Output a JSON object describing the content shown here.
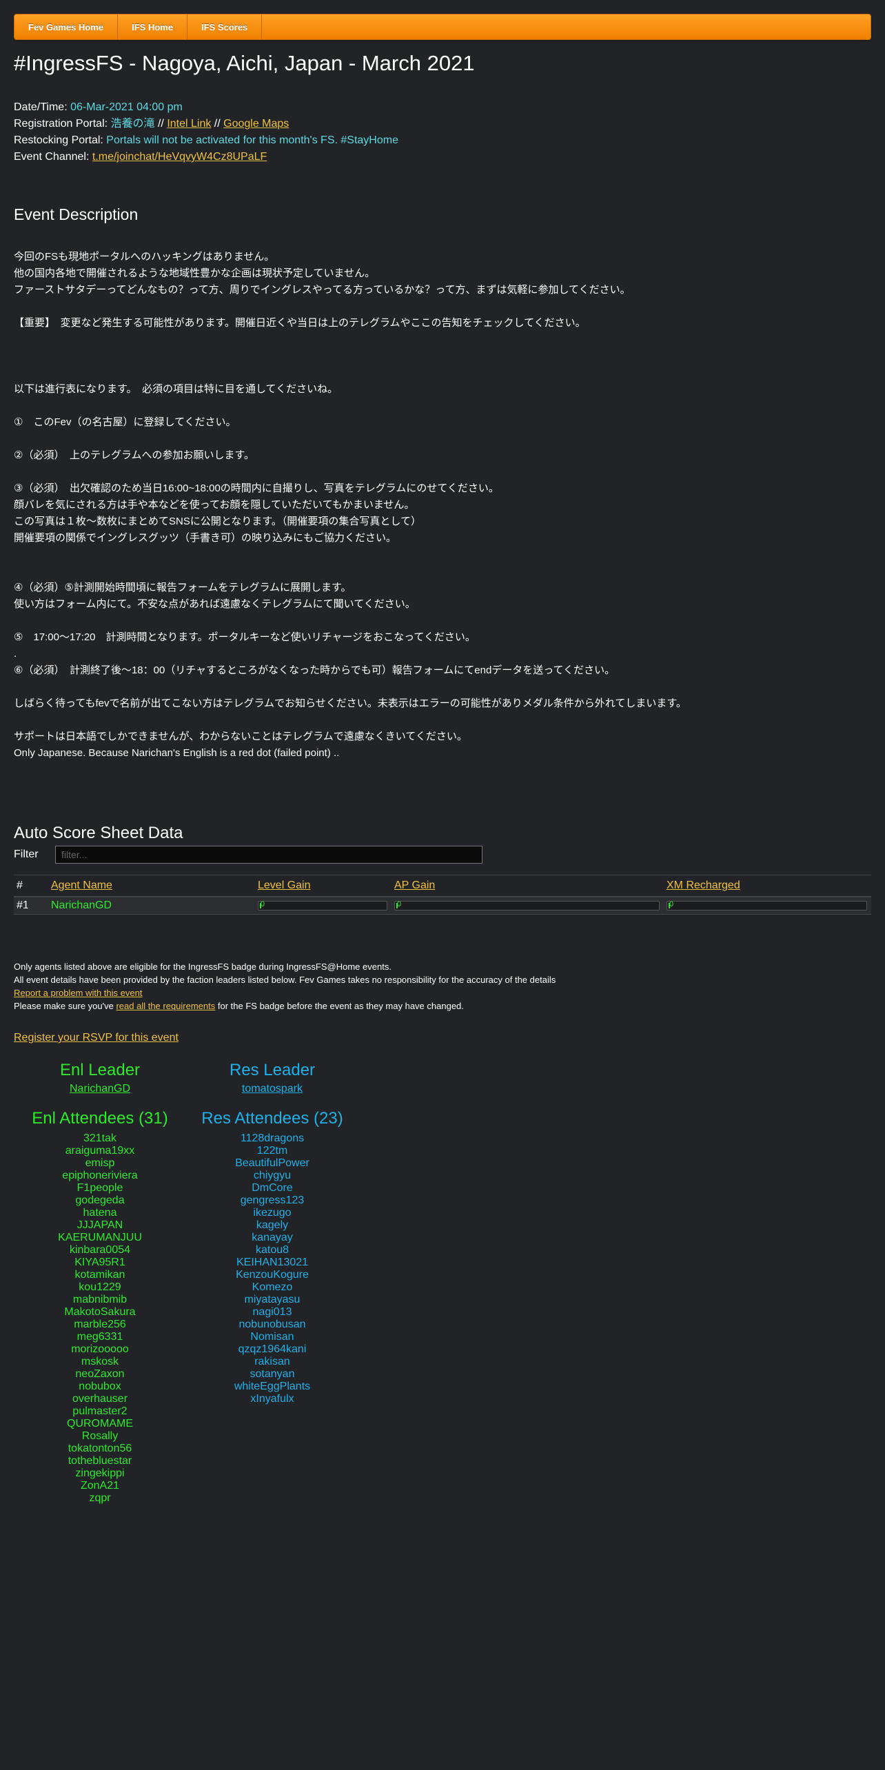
{
  "nav": {
    "items": [
      {
        "label": "Fev Games Home"
      },
      {
        "label": "IFS Home"
      },
      {
        "label": "IFS Scores"
      }
    ]
  },
  "title": "#IngressFS - Nagoya, Aichi, Japan - March 2021",
  "info": {
    "datetime_label": "Date/Time:",
    "datetime_value": "06-Mar-2021 04:00 pm",
    "reg_label": "Registration Portal:",
    "reg_portal": "浩養の滝",
    "sep1": " // ",
    "intel_link": "Intel Link",
    "sep2": " // ",
    "maps_link": "Google Maps",
    "restock_label": "Restocking Portal:",
    "restock_value": "Portals will not be activated for this month's FS. #StayHome",
    "channel_label": "Event Channel:",
    "channel_link": "t.me/joinchat/HeVqvyW4Cz8UPaLF"
  },
  "description": {
    "heading": "Event Description",
    "lines": [
      "今回のFSも現地ポータルへのハッキングはありません。",
      "他の国内各地で開催されるような地域性豊かな企画は現状予定していません。",
      "ファーストサタデーってどんなもの？って方、周りでイングレスやってる方っているかな？って方、まずは気軽に参加してください。",
      "",
      "【重要】　変更など発生する可能性があります。開催日近くや当日は上のテレグラムやここの告知をチェックしてください。",
      "",
      "",
      "",
      "以下は進行表になります。　必須の項目は特に目を通してくださいね。",
      "",
      "①　このFev（の名古屋）に登録してください。",
      "",
      "②（必須）　上のテレグラムへの参加お願いします。",
      "",
      "③（必須）　出欠確認のため当日16:00~18:00の時間内に自撮りし、写真をテレグラムにのせてください。",
      "顔バレを気にされる方は手や本などを使ってお顔を隠していただいてもかまいません。",
      "この写真は１枚～数枚にまとめてSNSに公開となります。（開催要項の集合写真として）",
      "開催要項の関係でイングレスグッツ（手書き可）の映り込みにもご協力ください。",
      "",
      "",
      "④（必須）⑤計測開始時間頃に報告フォームをテレグラムに展開します。",
      "使い方はフォーム内にて。不安な点があれば遠慮なくテレグラムにて聞いてください。",
      "",
      "⑤　17:00～17:20　計測時間となります。ポータルキーなど使いリチャージをおこなってください。",
      ".",
      "⑥（必須）　計測終了後～18：00（リチャするところがなくなった時からでも可）報告フォームにてendデータを送ってください。",
      "",
      "しばらく待ってもfevで名前が出てこない方はテレグラムでお知らせください。未表示はエラーの可能性がありメダル条件から外れてしまいます。",
      "",
      "サポートは日本語でしかできませんが、わからないことはテレグラムで遠慮なくきいてください。",
      "Only Japanese. Because Narichan's English is a red dot (failed point) .."
    ]
  },
  "scores": {
    "heading": "Auto Score Sheet Data",
    "filter_label": "Filter",
    "filter_placeholder": "filter...",
    "columns": [
      "#",
      "Agent Name",
      "Level Gain",
      "AP Gain",
      "XM Recharged"
    ],
    "rows": [
      {
        "rank": "#1",
        "agent": "NarichanGD",
        "level_gain": "0",
        "ap_gain": "0",
        "xm_recharged": "0"
      }
    ]
  },
  "notes": {
    "line1": "Only agents listed above are eligible for the IngressFS badge during IngressFS@Home events.",
    "line2": "All event details have been provided by the faction leaders listed below. Fev Games takes no responsibility for the accuracy of the details",
    "report_link": "Report a problem with this event",
    "line4_pre": "Please make sure you've ",
    "line4_link": "read all the requirements",
    "line4_post": " for the FS badge before the event as they may have changed.",
    "rsvp_link": "Register your RSVP for this event"
  },
  "factions": {
    "enl": {
      "leader_title": "Enl Leader",
      "leader": "NarichanGD",
      "attendees_title": "Enl Attendees (31)",
      "attendees": [
        "321tak",
        "araiguma19xx",
        "emisp",
        "epiphoneriviera",
        "F1people",
        "godegeda",
        "hatena",
        "JJJAPAN",
        "KAERUMANJUU",
        "kinbara0054",
        "KIYA95R1",
        "kotamikan",
        "kou1229",
        "mabnibmib",
        "MakotoSakura",
        "marble256",
        "meg6331",
        "morizooooo",
        "mskosk",
        "neoZaxon",
        "nobubox",
        "overhauser",
        "pulmaster2",
        "QUROMAME",
        "Rosally",
        "tokatonton56",
        "tothebluestar",
        "zingekippi",
        "ZonA21",
        "zqpr"
      ]
    },
    "res": {
      "leader_title": "Res Leader",
      "leader": "tomatospark",
      "attendees_title": "Res Attendees (23)",
      "attendees": [
        "1128dragons",
        "122tm",
        "BeautifulPower",
        "chiygyu",
        "DmCore",
        "gengress123",
        "ikezugo",
        "kagely",
        "kanayay",
        "katou8",
        "KEIHAN13021",
        "KenzouKogure",
        "Komezo",
        "miyatayasu",
        "nagi013",
        "nobunobusan",
        "Nomisan",
        "qzqz1964kani",
        "rakisan",
        "sotanyan",
        "whiteEggPlants",
        "xInyafulx"
      ]
    }
  },
  "colors": {
    "background": "#212326",
    "accent_orange": "#f08000",
    "link": "#f0c040",
    "enl": "#2ee82e",
    "res": "#20b0e8",
    "cyan": "#5ed9e2"
  }
}
